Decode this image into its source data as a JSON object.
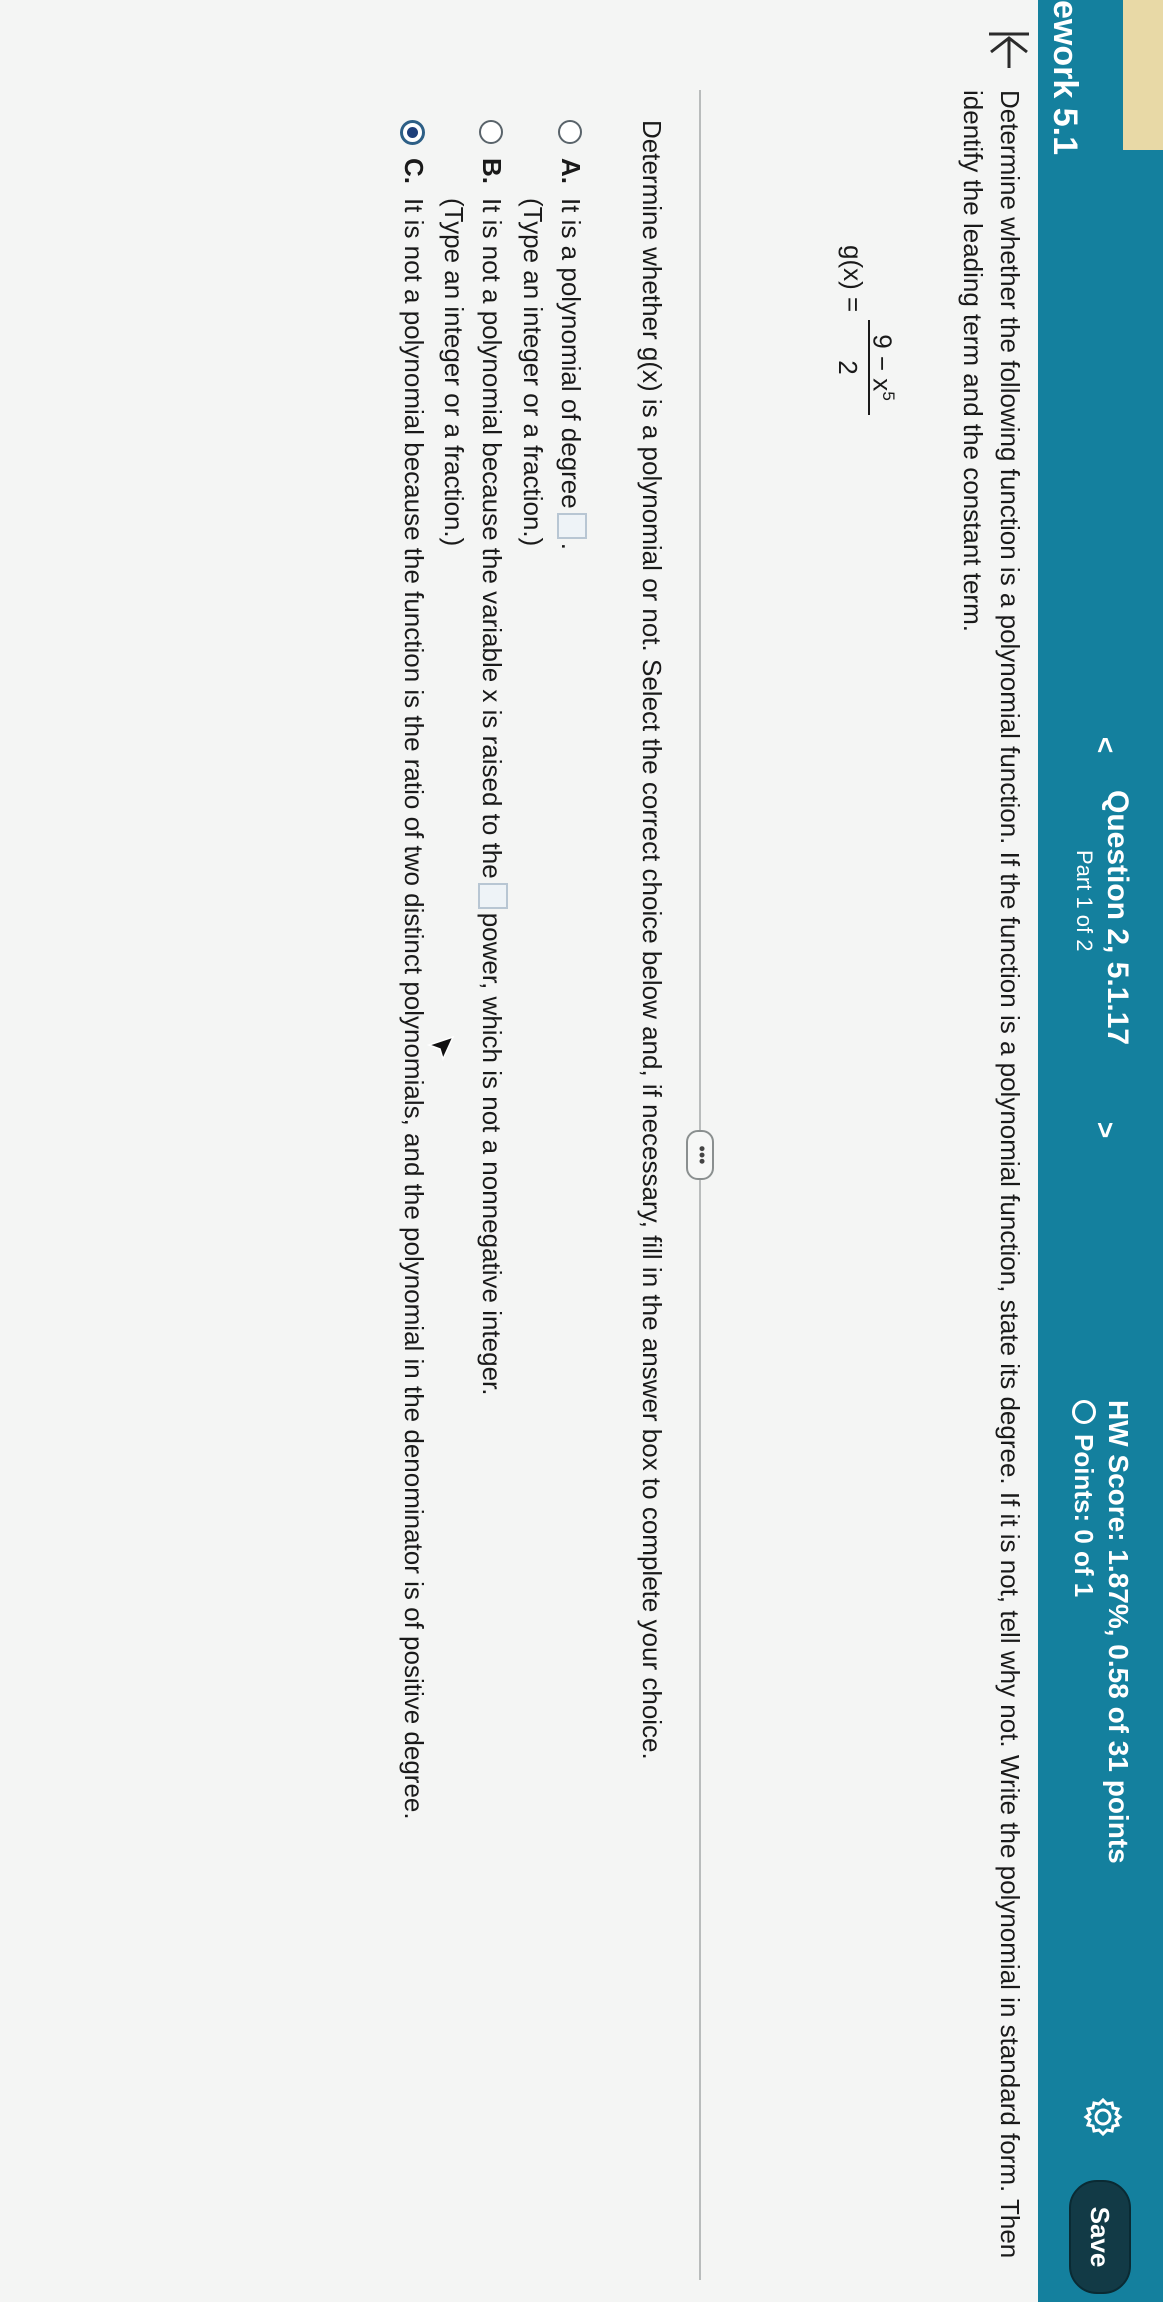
{
  "header": {
    "assignment_title": "ework 5.1",
    "question_title": "Question 2, 5.1.17",
    "question_part": "Part 1 of 2",
    "prev_glyph": "<",
    "next_glyph": ">",
    "hw_score": "HW Score: 1.87%, 0.58 of 31 points",
    "points": "Points: 0 of 1",
    "save_label": "Save",
    "gear_icon": "gear-icon"
  },
  "problem": {
    "prompt": "Determine whether the following function is a polynomial function. If the function is a polynomial function, state its degree. If it is not, tell why not. Write the polynomial in standard form. Then identify the leading term and the constant term.",
    "function_name": "g(x) =",
    "numerator": "9 − x",
    "exponent": "5",
    "denominator": "2",
    "more_label": "•••"
  },
  "question": {
    "instruction": "Determine whether g(x) is a polynomial or not. Select the correct choice below and, if necessary, fill in the answer box to complete your choice.",
    "choices": [
      {
        "letter": "A.",
        "text_before": "It is a polynomial of degree",
        "text_after": ".",
        "hint": "(Type an integer or a fraction.)",
        "selected": false
      },
      {
        "letter": "B.",
        "text_before": "It is not a polynomial because the variable x is raised to the",
        "text_after": "power, which is not a nonnegative integer.",
        "hint": "(Type an integer or a fraction.)",
        "selected": false
      },
      {
        "letter": "C.",
        "text": "It is not a polynomial because the function is the ratio of two distinct polynomials, and the polynomial in the denominator is of positive degree.",
        "selected": true
      }
    ]
  },
  "colors": {
    "header_bg": "#14809e",
    "save_bg": "#123a46",
    "selected_radio": "#1e3f7a"
  }
}
